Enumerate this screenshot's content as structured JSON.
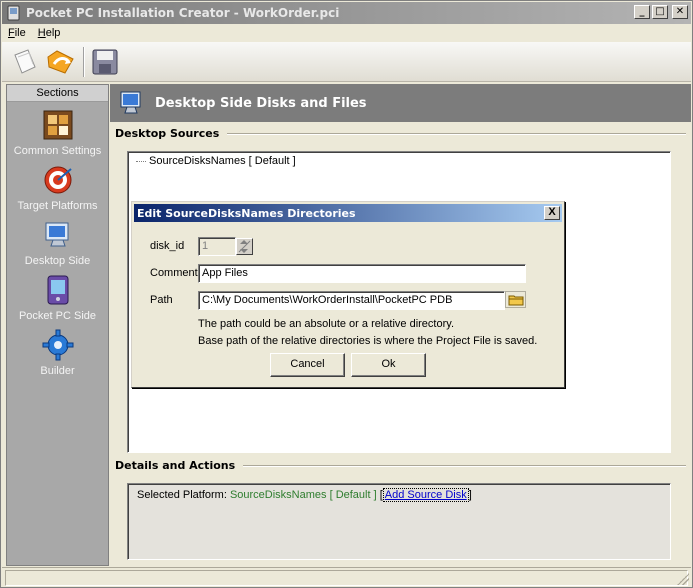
{
  "window": {
    "title": "Pocket PC Installation Creator - WorkOrder.pci"
  },
  "menu": {
    "items": [
      {
        "label_u": "F",
        "label_rest": "ile"
      },
      {
        "label_u": "H",
        "label_rest": "elp"
      }
    ]
  },
  "toolbar": {
    "icons": [
      "new-file-icon",
      "open-folder-icon",
      "save-disk-icon"
    ]
  },
  "sidebar": {
    "header": "Sections",
    "items": [
      {
        "label": "Common Settings",
        "icon": "settings-grid-icon"
      },
      {
        "label": "Target Platforms",
        "icon": "target-icon"
      },
      {
        "label": "Desktop Side",
        "icon": "monitor-icon"
      },
      {
        "label": "Pocket PC Side",
        "icon": "pocketpc-icon"
      },
      {
        "label": "Builder",
        "icon": "gear-icon"
      }
    ]
  },
  "panel": {
    "title": "Desktop Side Disks and Files",
    "sources_label": "Desktop Sources",
    "tree_node": "SourceDisksNames [ Default ]",
    "details_label": "Details and Actions",
    "details_prefix": "Selected Platform:",
    "details_platform": "SourceDisksNames [ Default ]",
    "details_bracket_open": "[",
    "details_link": "Add Source Disk",
    "details_bracket_close": "]"
  },
  "dialog": {
    "title": "Edit SourceDisksNames Directories",
    "close_label": "X",
    "disk_id_label": "disk_id",
    "disk_id_value": "1",
    "comment_label": "Comment",
    "comment_value": "App Files",
    "path_label": "Path",
    "path_value": "C:\\My Documents\\WorkOrderInstall\\PocketPC PDB",
    "hint1": "The path could be an absolute or a relative directory.",
    "hint2": "Base path of the relative directories is where the Project File is saved.",
    "cancel_label": "Cancel",
    "ok_label": "Ok"
  },
  "colors": {
    "title_active": "#0a246a",
    "title_inactive": "#7a7a7a",
    "panel_header": "#7c7c7c",
    "sidebar": "#a8a8a8",
    "link": "#0000cc",
    "platform_green": "#2e7d2e"
  }
}
